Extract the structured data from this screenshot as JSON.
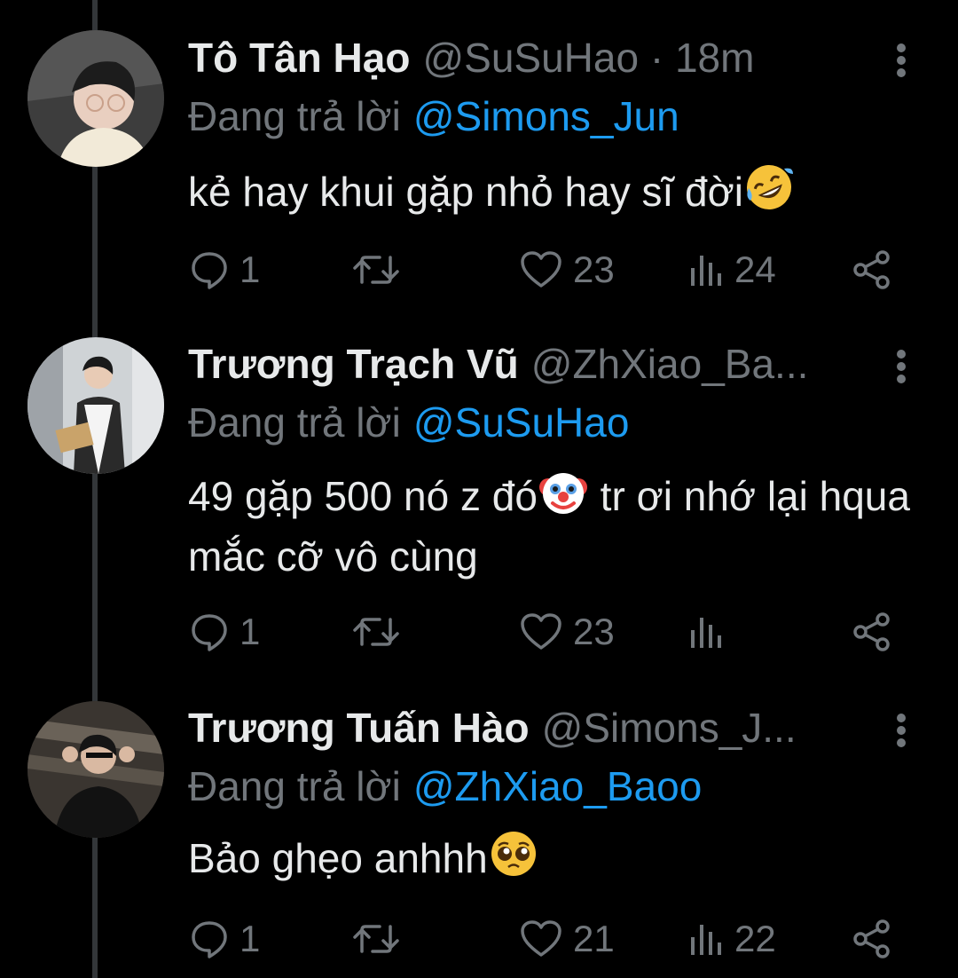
{
  "tweets": [
    {
      "display_name": "Tô Tân Hạo",
      "meta": "@SuSuHao · 18m",
      "replying_label": "Đang trả lời",
      "replying_to": "@Simons_Jun",
      "text": "kẻ hay khui gặp nhỏ hay sĩ đời",
      "text_emoji": "rolling-on-floor-laughing-emoji",
      "reply_count": "1",
      "like_count": "23",
      "view_count": "24"
    },
    {
      "display_name": "Trương Trạch Vũ",
      "meta": "@ZhXiao_Ba...",
      "replying_label": "Đang trả lời",
      "replying_to": "@SuSuHao",
      "text_part1": "49 gặp 500 nó z đó",
      "text_emoji": "clown-face-emoji",
      "text_part2": " tr ơi nhớ lại hqua mắc cỡ vô cùng",
      "reply_count": "1",
      "like_count": "23",
      "view_count": ""
    },
    {
      "display_name": "Trương Tuấn Hào",
      "meta": "@Simons_J...",
      "replying_label": "Đang trả lời",
      "replying_to": "@ZhXiao_Baoo",
      "text": "Bảo ghẹo anhhh",
      "text_emoji": "pleading-face-emoji",
      "reply_count": "1",
      "like_count": "21",
      "view_count": "22"
    }
  ],
  "colors": {
    "background": "#000000",
    "primary_text": "#e7e9ea",
    "secondary_text": "#71767b",
    "accent": "#1d9bf0",
    "thread_line": "#333639"
  },
  "icons": {
    "reply": "reply-bubble-icon",
    "retweet": "retweet-icon",
    "like": "heart-icon",
    "views": "views-bar-chart-icon",
    "share": "share-icon",
    "more": "more-vertical-icon"
  }
}
